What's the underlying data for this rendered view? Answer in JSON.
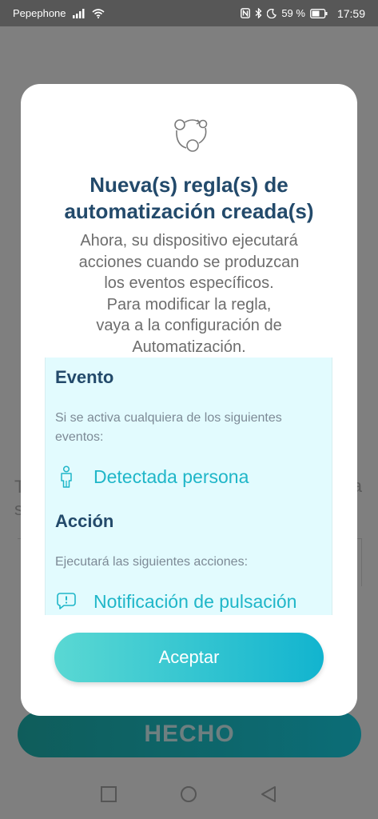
{
  "status_bar": {
    "carrier": "Pepephone",
    "battery": "59 %",
    "time": "17:59",
    "icons": [
      "signal-icon",
      "wifi-icon",
      "nfc-icon",
      "bluetooth-icon",
      "moon-icon",
      "battery-icon"
    ]
  },
  "background": {
    "partial_left_text_1": "T",
    "partial_left_text_2": "s",
    "partial_right_text": "a",
    "done_label": "HECHO"
  },
  "dialog": {
    "icon": "automation-icon",
    "title": "Nueva(s) regla(s) de automatización creada(s)",
    "body": "Ahora, su dispositivo ejecutará\nacciones cuando se produzcan\nlos eventos específicos.\nPara modificar la regla,\nvaya a la configuración de\nAutomatización.",
    "event_title": "Evento",
    "event_desc": "Si se activa cualquiera de los siguientes eventos:",
    "event_item": "Detectada persona",
    "event_item_icon": "person-icon",
    "action_title": "Acción",
    "action_desc": "Ejecutará las siguientes acciones:",
    "action_item": "Notificación de pulsación",
    "action_item_icon": "notification-icon",
    "accept_label": "Aceptar"
  },
  "nav_bar": {
    "icons": [
      "recents-square-icon",
      "home-circle-icon",
      "back-triangle-icon"
    ]
  },
  "colors": {
    "title": "#234a6b",
    "accent": "#1fb6c8",
    "card_bg": "#e2fbfe"
  }
}
